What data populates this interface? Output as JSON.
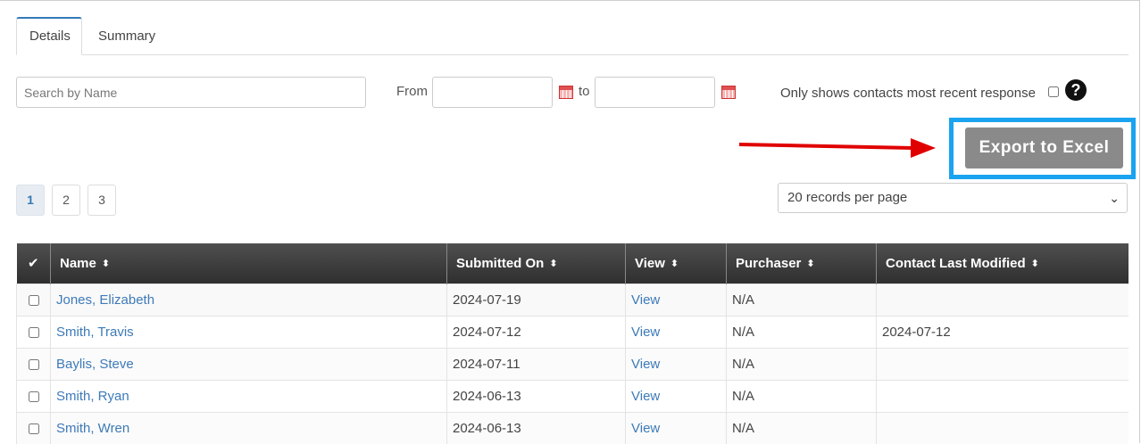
{
  "tabs": [
    {
      "label": "Details",
      "active": true
    },
    {
      "label": "Summary",
      "active": false
    }
  ],
  "filters": {
    "search_placeholder": "Search by Name",
    "search_value": "",
    "from_label": "From",
    "to_label": "to",
    "from_value": "",
    "to_value": "",
    "recent_only_label": "Only shows contacts most recent response",
    "recent_only_checked": false
  },
  "icons": {
    "calendar": "calendar-icon",
    "help": "question-circle-icon",
    "sort": "sort-icon",
    "check": "check-icon",
    "chevron": "chevron-down-icon"
  },
  "export": {
    "label": "Export to Excel",
    "highlight_color": "#1aa3f0",
    "arrow_color": "#e00000"
  },
  "pagination": {
    "pages": [
      "1",
      "2",
      "3"
    ],
    "current": "1",
    "per_page_value": "20 records per page"
  },
  "table": {
    "columns": [
      "Name",
      "Submitted On",
      "View",
      "Purchaser",
      "Contact Last Modified"
    ],
    "header_check_glyph": "✔",
    "sort_glyph": "⬍",
    "rows": [
      {
        "name": "Jones, Elizabeth",
        "submitted_on": "2024-07-19",
        "view": "View",
        "purchaser": "N/A",
        "contact_last_modified": ""
      },
      {
        "name": "Smith, Travis",
        "submitted_on": "2024-07-12",
        "view": "View",
        "purchaser": "N/A",
        "contact_last_modified": "2024-07-12"
      },
      {
        "name": "Baylis, Steve",
        "submitted_on": "2024-07-11",
        "view": "View",
        "purchaser": "N/A",
        "contact_last_modified": ""
      },
      {
        "name": "Smith, Ryan",
        "submitted_on": "2024-06-13",
        "view": "View",
        "purchaser": "N/A",
        "contact_last_modified": ""
      },
      {
        "name": "Smith, Wren",
        "submitted_on": "2024-06-13",
        "view": "View",
        "purchaser": "N/A",
        "contact_last_modified": ""
      }
    ]
  }
}
